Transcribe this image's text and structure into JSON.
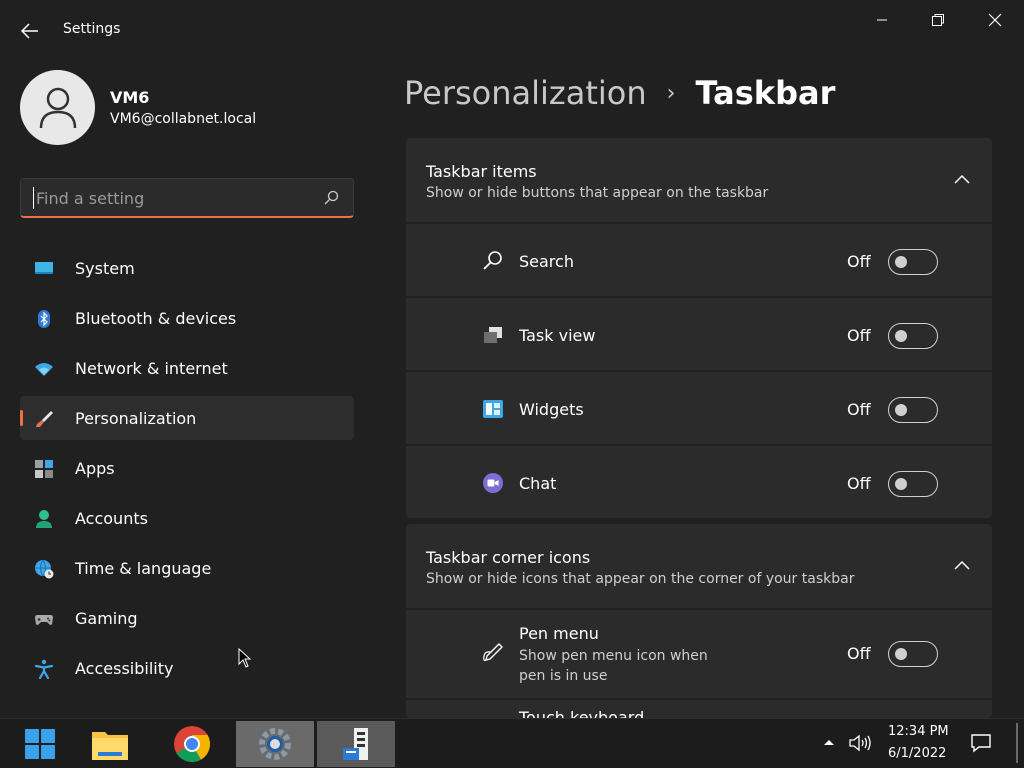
{
  "window": {
    "title": "Settings",
    "back_icon": "back-arrow-icon",
    "controls": [
      "minimize-icon",
      "maximize-icon",
      "close-icon"
    ]
  },
  "profile": {
    "name": "VM6",
    "email": "VM6@collabnet.local",
    "avatar_icon": "person-icon"
  },
  "search": {
    "placeholder": "Find a setting",
    "value": "",
    "icon": "search-icon"
  },
  "sidebar": {
    "items": [
      {
        "label": "System",
        "icon": "system-icon",
        "selected": false
      },
      {
        "label": "Bluetooth & devices",
        "icon": "bluetooth-icon",
        "selected": false
      },
      {
        "label": "Network & internet",
        "icon": "wifi-icon",
        "selected": false
      },
      {
        "label": "Personalization",
        "icon": "paintbrush-icon",
        "selected": true
      },
      {
        "label": "Apps",
        "icon": "apps-icon",
        "selected": false
      },
      {
        "label": "Accounts",
        "icon": "account-icon",
        "selected": false
      },
      {
        "label": "Time & language",
        "icon": "globe-clock-icon",
        "selected": false
      },
      {
        "label": "Gaming",
        "icon": "gamepad-icon",
        "selected": false
      },
      {
        "label": "Accessibility",
        "icon": "accessibility-icon",
        "selected": false
      }
    ]
  },
  "breadcrumb": {
    "parent": "Personalization",
    "separator": "›",
    "current": "Taskbar"
  },
  "sections": [
    {
      "title": "Taskbar items",
      "subtitle": "Show or hide buttons that appear on the taskbar",
      "expanded": true,
      "rows": [
        {
          "label": "Search",
          "state": "Off",
          "on": false,
          "icon": "search-icon"
        },
        {
          "label": "Task view",
          "state": "Off",
          "on": false,
          "icon": "task-view-icon"
        },
        {
          "label": "Widgets",
          "state": "Off",
          "on": false,
          "icon": "widgets-icon"
        },
        {
          "label": "Chat",
          "state": "Off",
          "on": false,
          "icon": "chat-icon"
        }
      ]
    },
    {
      "title": "Taskbar corner icons",
      "subtitle": "Show or hide icons that appear on the corner of your taskbar",
      "expanded": true,
      "rows": [
        {
          "label": "Pen menu",
          "description": "Show pen menu icon when pen is in use",
          "state": "Off",
          "on": false,
          "icon": "pen-icon"
        },
        {
          "label": "Touch keyboard",
          "icon": "keyboard-icon"
        }
      ]
    }
  ],
  "taskbar": {
    "apps": [
      {
        "name": "Start",
        "icon": "windows-start-icon"
      },
      {
        "name": "File Explorer",
        "icon": "folder-icon"
      },
      {
        "name": "Google Chrome",
        "icon": "chrome-icon"
      },
      {
        "name": "Settings",
        "icon": "settings-gear-icon"
      },
      {
        "name": "Server Manager",
        "icon": "server-manager-icon"
      }
    ],
    "tray": {
      "time": "12:34 PM",
      "date": "6/1/2022",
      "icons": [
        "chevron-up-icon",
        "volume-icon",
        "notification-icon"
      ]
    }
  },
  "colors": {
    "background": "#202020",
    "card": "#2b2b2b",
    "accent": "#e8704c",
    "taskbar": "#1c1c1c"
  }
}
